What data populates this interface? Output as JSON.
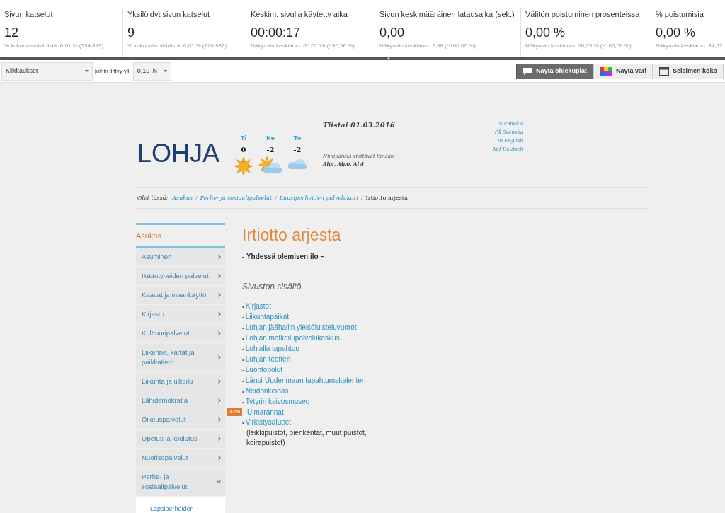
{
  "metrics": [
    {
      "label": "Sivun katselut",
      "value": "12",
      "note": "% kokonaismäärästä: 0,01 % (154 828)"
    },
    {
      "label": "Yksilöidyt sivun katselut",
      "value": "9",
      "note": "% kokonaismäärästä: 0,01 % (120 982)"
    },
    {
      "label": "Keskim. sivulla käytetty aika",
      "value": "00:00:17",
      "note": "Näkymän keskiarvo: 00:01:26 (−80,56 %)"
    },
    {
      "label": "Sivun keskimääräinen latausaika (sek.)",
      "value": "0,00",
      "note": "Näkymän keskiarvo: 2,68 (−100,00 %)"
    },
    {
      "label": "Välitön poistuminen prosenteissa",
      "value": "0,00 %",
      "note": "Näkymän keskiarvo: 50,29 % (−100,00 %)"
    },
    {
      "label": "% poistumisia",
      "value": "0,00 %",
      "note": "Näkymän keskiarvo: 34,57"
    }
  ],
  "toolbar": {
    "metric_select": "Klikkaukset",
    "threshold_label": "joihin liittyy yli:",
    "threshold_select": "0,10 %",
    "buttons": [
      {
        "label": "Näytä ohjekuplat",
        "kind": "bubbles",
        "selected": true
      },
      {
        "label": "Näytä väri",
        "kind": "color",
        "selected": false
      },
      {
        "label": "Selaimen koko",
        "kind": "browser",
        "selected": false
      }
    ]
  },
  "site": {
    "logo": "LOHJA",
    "weather": [
      {
        "day": "Ti",
        "temp": "0",
        "kind": "sunny"
      },
      {
        "day": "Ke",
        "temp": "-2",
        "kind": "partly"
      },
      {
        "day": "To",
        "temp": "-2",
        "kind": "cloudy"
      }
    ],
    "date": "Tiistai 01.03.2016",
    "nameday_label": "Nimipäivää viettävät tänään",
    "nameday_names": "Alpi, Alpo, Alvi",
    "languages": [
      "Suomeksi",
      "På Svenska",
      "In English",
      "Auf Deutsch"
    ],
    "breadcrumb": {
      "label": "Olet tässä:",
      "links": [
        "Asukas",
        "Perhe- ja sosiaalipalvelut",
        "Lapsiperheiden palvelukori"
      ],
      "current": "Irtiotto arjesta",
      "separator": "/"
    },
    "sidebar": {
      "title": "Asukas",
      "items": [
        {
          "label": "Asuminen",
          "expanded": false
        },
        {
          "label": "Ikääntyneiden palvelut",
          "expanded": false
        },
        {
          "label": "Kaavat ja maankäyttö",
          "expanded": false
        },
        {
          "label": "Kirjasto",
          "expanded": false
        },
        {
          "label": "Kulttuuripalvelut",
          "expanded": false
        },
        {
          "label": "Liikenne, kartat ja paikkatieto",
          "expanded": false
        },
        {
          "label": "Liikunta ja ulkoilu",
          "expanded": false
        },
        {
          "label": "Lähidemokratia",
          "expanded": false
        },
        {
          "label": "Oikeuspalvelut",
          "expanded": false
        },
        {
          "label": "Opetus ja koulutus",
          "expanded": false
        },
        {
          "label": "Nuorisopalvelut",
          "expanded": false
        },
        {
          "label": "Perhe- ja sosiaalipalvelut",
          "expanded": true,
          "children": [
            {
              "label": "Lapsiperheiden",
              "selected": true
            }
          ]
        }
      ]
    },
    "article": {
      "title": "Irtiotto arjesta",
      "lead": "- Yhdessä olemisen ilo –",
      "section": "Sivuston sisältö",
      "links": [
        {
          "bullet": "•",
          "label": "Kirjastot"
        },
        {
          "bullet": "•",
          "label": "Liikuntapaikat"
        },
        {
          "bullet": "•",
          "label": "Lohjan jäähallin yleisöluisteluvuorot"
        },
        {
          "bullet": "•",
          "label": "Lohjan matkailupalvelukeskus"
        },
        {
          "bullet": "•",
          "label": "Lohjalla tapahtuu"
        },
        {
          "bullet": "•",
          "label": "Lohjan teatteri"
        },
        {
          "bullet": "•",
          "label": "Luontopolut"
        },
        {
          "bullet": "•",
          "label": "Länsi-Uudenmaan tapahtumakalenteri"
        },
        {
          "bullet": "•",
          "label": "Neidonkeidas"
        },
        {
          "bullet": "•",
          "label": "Tytyrin kaivosmuseo"
        },
        {
          "label": "Uimarannat",
          "click_share": "33%"
        },
        {
          "bullet": "•",
          "label": "Virkistysalueet",
          "note": "(leikkipuistot, pienkentät, muut puistot, koirapuistot)"
        }
      ]
    }
  }
}
